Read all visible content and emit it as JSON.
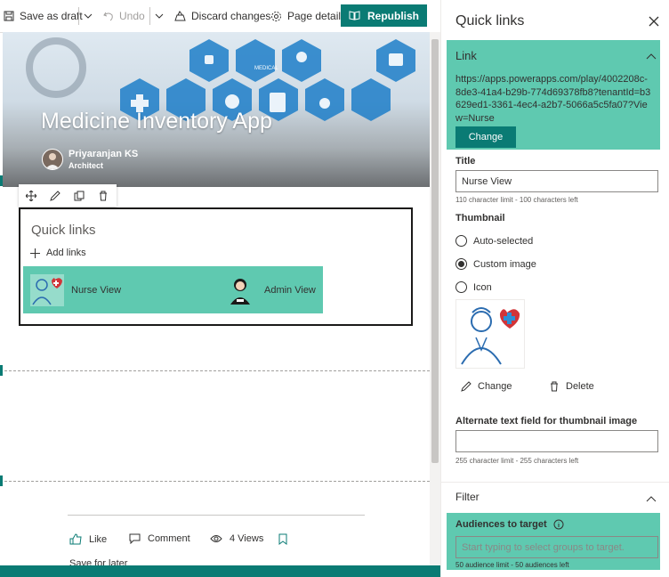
{
  "toolbar": {
    "save_draft": "Save as draft",
    "undo": "Undo",
    "discard": "Discard changes",
    "page_details": "Page details",
    "republish": "Republish"
  },
  "hero": {
    "title": "Medicine Inventory App",
    "author": "Priyaranjan KS",
    "role": "Architect",
    "icon_label": "MEDICAL"
  },
  "quick_links": {
    "title": "Quick links",
    "add_links": "Add links",
    "items": [
      {
        "label": "Nurse View"
      },
      {
        "label": "Admin View"
      }
    ]
  },
  "social": {
    "like": "Like",
    "comment": "Comment",
    "views": "4 Views",
    "save_later": "Save for later"
  },
  "panel": {
    "title": "Quick links",
    "link_heading": "Link",
    "url": "https://apps.powerapps.com/play/4002208c-8de3-41a4-b29b-774d69378fb8?tenantId=b3629ed1-3361-4ec4-a2b7-5066a5c5fa07?View=Nurse",
    "change_button": "Change",
    "title_label": "Title",
    "title_value": "Nurse View",
    "title_hint": "110 character limit - 100 characters left",
    "thumbnail_label": "Thumbnail",
    "thumbnail_options": [
      {
        "label": "Auto-selected",
        "selected": false
      },
      {
        "label": "Custom image",
        "selected": true
      },
      {
        "label": "Icon",
        "selected": false
      }
    ],
    "thumb_change": "Change",
    "thumb_delete": "Delete",
    "alt_label": "Alternate text field for thumbnail image",
    "alt_value": "",
    "alt_hint": "255 character limit - 255 characters left",
    "filter_heading": "Filter",
    "audiences_label": "Audiences to target",
    "audiences_placeholder": "Start typing to select groups to target.",
    "audiences_hint": "50 audience limit - 50 audiences left"
  },
  "colors": {
    "accent": "#0a7b74",
    "highlight": "#5fc9b0"
  }
}
